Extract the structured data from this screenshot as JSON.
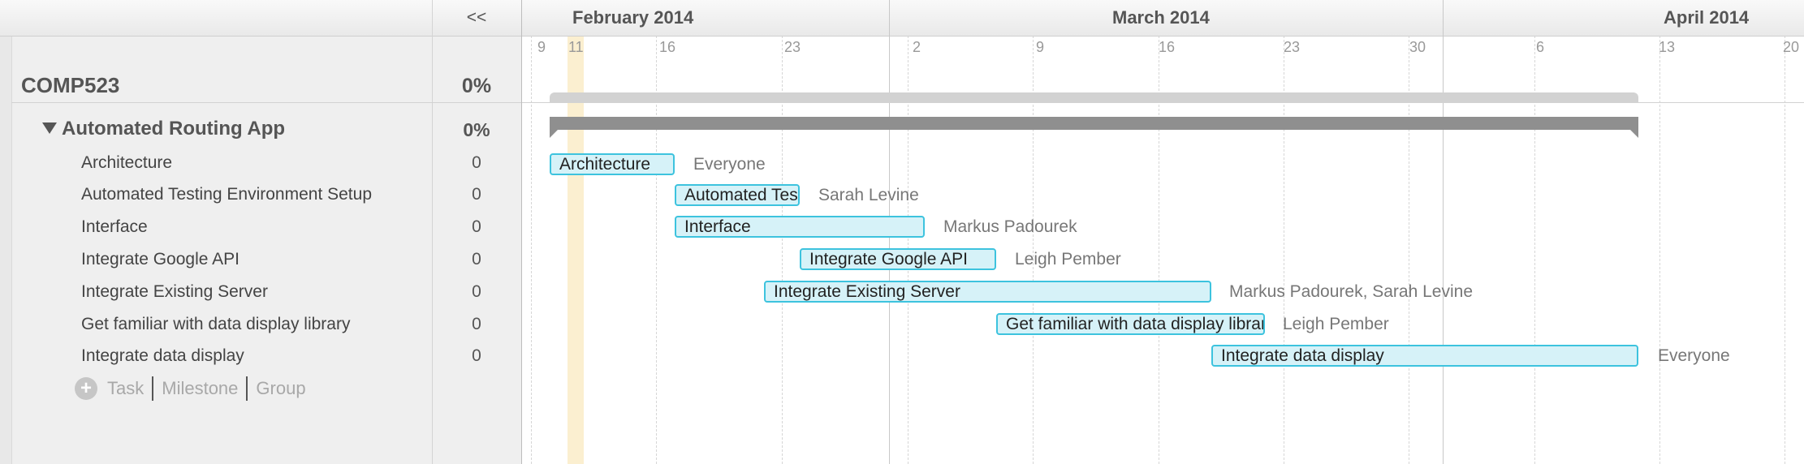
{
  "toolbar": {
    "collapse_label": "<<"
  },
  "project": {
    "name": "COMP523",
    "percent": "0%"
  },
  "group": {
    "name": "Automated Routing App",
    "percent": "0%"
  },
  "tasks": [
    {
      "name": "Architecture",
      "percent": "0",
      "bar_label": "Architecture",
      "assignee": "Everyone"
    },
    {
      "name": "Automated Testing Environment Setup",
      "percent": "0",
      "bar_label": "Automated Testing Environment Setup",
      "assignee": "Sarah Levine"
    },
    {
      "name": "Interface",
      "percent": "0",
      "bar_label": "Interface",
      "assignee": "Markus Padourek"
    },
    {
      "name": "Integrate Google API",
      "percent": "0",
      "bar_label": "Integrate Google API",
      "assignee": "Leigh Pember"
    },
    {
      "name": "Integrate Existing Server",
      "percent": "0",
      "bar_label": "Integrate Existing Server",
      "assignee": "Markus Padourek, Sarah Levine"
    },
    {
      "name": "Get familiar with data display library",
      "percent": "0",
      "bar_label": "Get familiar with data display library",
      "assignee": "Leigh Pember"
    },
    {
      "name": "Integrate data display",
      "percent": "0",
      "bar_label": "Integrate data display",
      "assignee": "Everyone"
    }
  ],
  "add_row": {
    "icon": "plus-circle-icon",
    "task": "Task",
    "milestone": "Milestone",
    "group": "Group"
  },
  "timeline": {
    "months": [
      "February 2014",
      "March 2014",
      "April 2014"
    ],
    "days": [
      "9",
      "11",
      "16",
      "23",
      "2",
      "9",
      "16",
      "23",
      "30",
      "6",
      "13",
      "20"
    ]
  },
  "colors": {
    "bar_fill": "#d6f2f8",
    "bar_border": "#3dc3de",
    "group_bar": "#8f8f8f",
    "today_highlight": "#fbefd0"
  }
}
